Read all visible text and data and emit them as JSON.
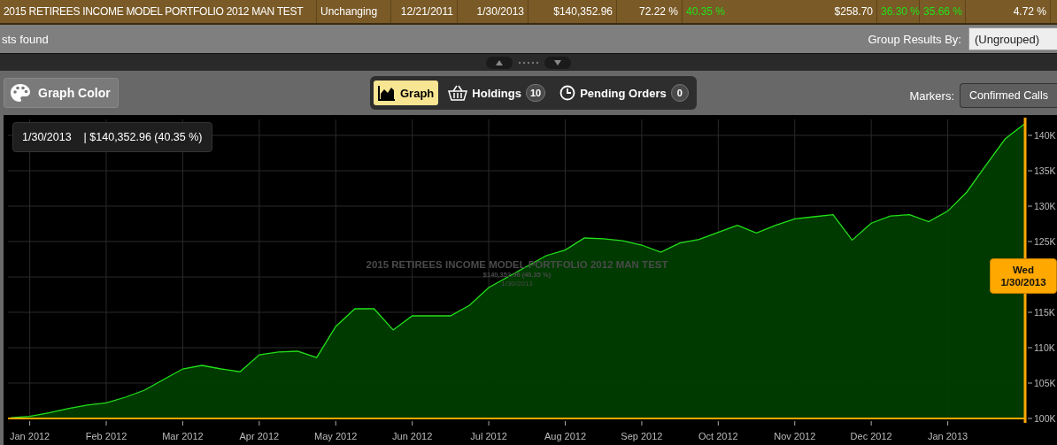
{
  "portfolio_row": {
    "cells": [
      {
        "text": "2015 RETIREES INCOME MODEL PORTFOLIO 2012 MAN TEST",
        "color": "#ffffff"
      },
      {
        "text": "Unchanging",
        "color": "#ffffff"
      },
      {
        "text": "12/21/2011",
        "color": "#ffffff"
      },
      {
        "text": "1/30/2013",
        "color": "#ffffff"
      },
      {
        "text": "$140,352.96",
        "color": "#ffffff"
      },
      {
        "text": "72.22 %",
        "color": "#ffffff"
      },
      {
        "text": "40.35 %",
        "color": "#22e01a"
      },
      {
        "text": "$258.70",
        "color": "#ffffff"
      },
      {
        "text": "36.30 %",
        "color": "#22e01a"
      },
      {
        "text": "35.66 %",
        "color": "#22e01a"
      },
      {
        "text": "4.72 %",
        "color": "#ffffff"
      }
    ]
  },
  "results_bar": {
    "status": "sts found",
    "group_label": "Group Results By:",
    "group_value": "(Ungrouped)"
  },
  "toolbar": {
    "graph_color": "Graph Color",
    "tabs": [
      {
        "label": "Graph",
        "selected": true,
        "kind": "graph"
      },
      {
        "label": "Holdings",
        "selected": false,
        "kind": "holdings",
        "count": "10"
      },
      {
        "label": "Pending Orders",
        "selected": false,
        "kind": "orders",
        "count": "0"
      }
    ],
    "markers_label": "Markers:",
    "markers_value": "Confirmed Calls"
  },
  "chart": {
    "tooltip_date": "1/30/2013",
    "tooltip_value": "| $140,352.96 (40.35 %)",
    "watermark_value": "$140,352.96 (40.35 %)",
    "watermark_date": "1/30/2013",
    "marker_day": "Wed",
    "marker_date": "1/30/2013",
    "chart_data": {
      "type": "area",
      "title": "2015 RETIREES INCOME MODEL PORTFOLIO 2012 MAN TEST",
      "categories": [
        null,
        "Jan 2012",
        null,
        null,
        null,
        "Feb 2012",
        null,
        null,
        null,
        "Mar 2012",
        null,
        null,
        null,
        "Apr 2012",
        null,
        null,
        null,
        "May 2012",
        null,
        null,
        null,
        "Jun 2012",
        null,
        null,
        null,
        "Jul 2012",
        null,
        null,
        null,
        "Aug 2012",
        null,
        null,
        null,
        "Sep 2012",
        null,
        null,
        null,
        "Oct 2012",
        null,
        null,
        null,
        "Nov 2012",
        null,
        null,
        null,
        "Dec 2012",
        null,
        null,
        null,
        "Jan 2013",
        null,
        null,
        null,
        null
      ],
      "series": [
        {
          "color": "#22e01a",
          "values": [
            100.1,
            100.3,
            100.8,
            101.4,
            101.9,
            102.2,
            103,
            104,
            105.5,
            107,
            107.5,
            107,
            106.6,
            109,
            109.4,
            109.5,
            108.6,
            113,
            115.5,
            115.5,
            112.5,
            114.5,
            114.5,
            114.5,
            116,
            118.5,
            120,
            121.5,
            123,
            123.8,
            125.5,
            125.4,
            125.1,
            124.5,
            123.5,
            124.8,
            125.3,
            126.3,
            127.3,
            126.2,
            127.3,
            128.2,
            128.5,
            128.8,
            125.2,
            127.6,
            128.6,
            128.8,
            127.8,
            129.3,
            132,
            135.8,
            139.5,
            141.6
          ]
        }
      ],
      "ylim": [
        100,
        142.25
      ],
      "grid": true,
      "yticks": [
        {
          "value": 100,
          "label": "100K"
        },
        {
          "value": 105,
          "label": "105K"
        },
        {
          "value": 110,
          "label": "110K"
        },
        {
          "value": 115,
          "label": "115K"
        },
        {
          "value": 125,
          "label": "125K"
        },
        {
          "value": 130,
          "label": "130K"
        },
        {
          "value": 135,
          "label": "135K"
        },
        {
          "value": 140,
          "label": "140K"
        }
      ]
    }
  }
}
